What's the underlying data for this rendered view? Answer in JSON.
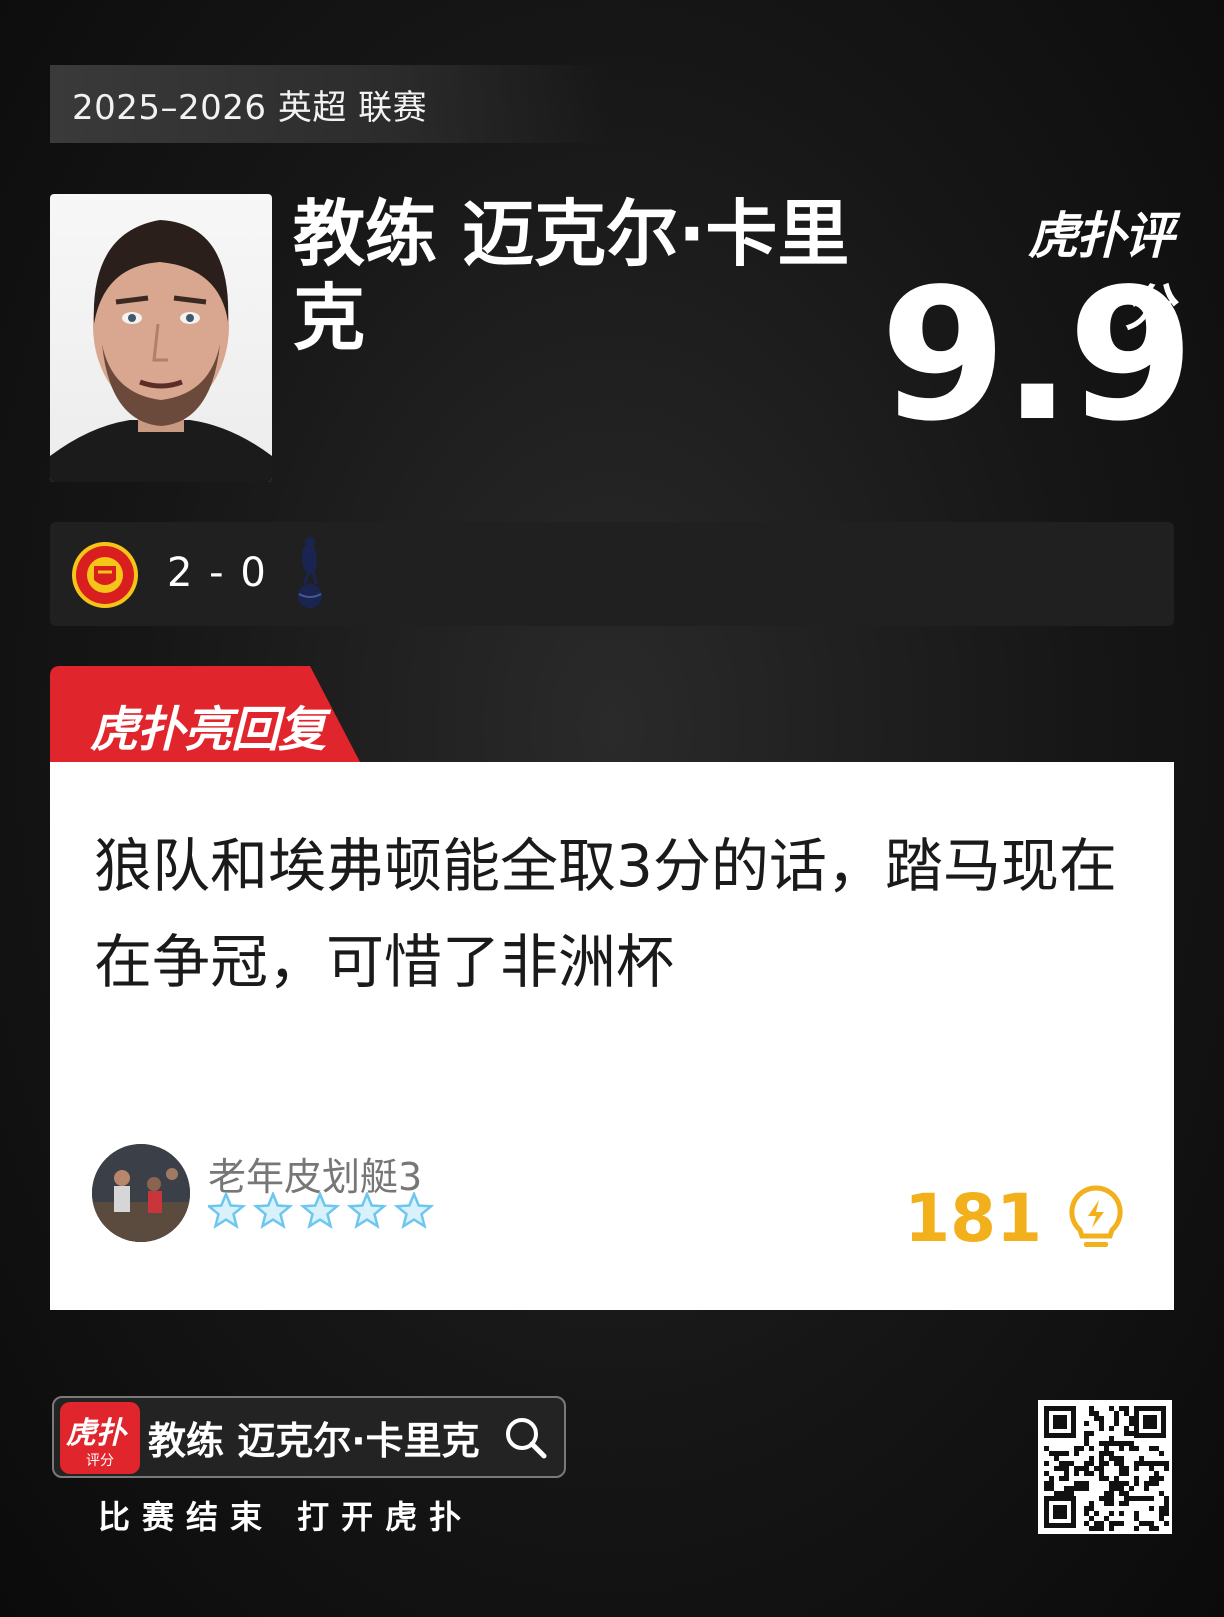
{
  "season": "2025–2026 英超 联赛",
  "coach": {
    "name": "教练 迈克尔·卡里克"
  },
  "rating": {
    "brand": "虎扑评分",
    "score": "9.9"
  },
  "match": {
    "score": "2 - 0",
    "home_crest": "manchester-united-crest",
    "away_crest": "tottenham-crest"
  },
  "reply": {
    "tab_label": "虎扑亮回复",
    "comment": "狼队和埃弗顿能全取3分的话，踏马现在在争冠，可惜了非洲杯",
    "username": "老年皮划艇3",
    "stars_count": 5,
    "likes": "181"
  },
  "footer": {
    "app_icon_text": "虎扑",
    "app_icon_subtext": "评分",
    "search_text": "教练 迈克尔·卡里克",
    "caption": "比赛结束 打开虎扑"
  },
  "colors": {
    "accent_red": "#e0262c",
    "like_gold": "#f2b11c",
    "star_blue": "#6cc7ee"
  }
}
